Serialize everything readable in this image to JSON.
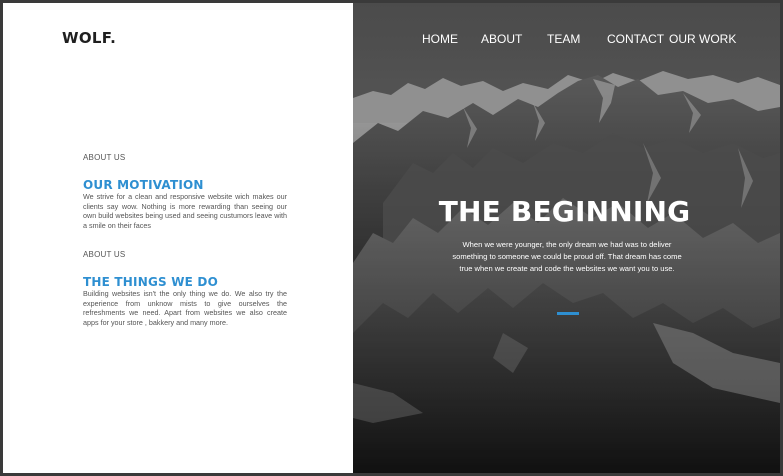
{
  "brand": {
    "logo": "WOLF."
  },
  "nav": {
    "items": [
      {
        "label": "HOME"
      },
      {
        "label": "ABOUT"
      },
      {
        "label": "TEAM"
      },
      {
        "label": "CONTACT"
      },
      {
        "label": "OUR WORK"
      }
    ]
  },
  "sections": [
    {
      "label": "ABOUT US",
      "heading": "OUR MOTIVATION",
      "text": "We strive for a clean and responsive website wich makes our clients say wow. Nothing is more rewarding than seeing our own build websites being used and seeing custumors leave with a smile on their faces"
    },
    {
      "label": "ABOUT US",
      "heading": "THE THINGS WE DO",
      "text": "Building websites isn't the only thing we do. We also try the experience from unknow mists to give ourselves the refreshments we need. Apart from websites we also create apps for your store , bakkery and many more."
    }
  ],
  "hero": {
    "title": "THE BEGINNING",
    "text": "When we were younger, the only dream we had was to deliver something to someone we could be proud off. That dream has come true when we create and code the websites we want you to use.",
    "accent_color": "#2e8fd1",
    "background": "grayscale mountain range photo"
  },
  "colors": {
    "accent": "#2e8fd1",
    "text_dark": "#1f1f1f",
    "text_muted": "#555555",
    "frame": "#3a3a3a"
  }
}
